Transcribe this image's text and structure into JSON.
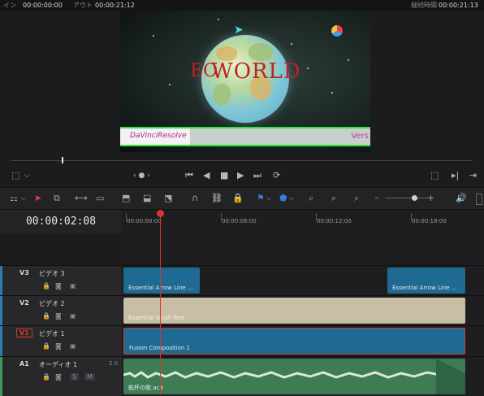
{
  "topbar": {
    "in_label": "イン",
    "in_time": "00:00:00:00",
    "out_label": "アウト",
    "out_time": "00:00:21:12",
    "duration_label": "継続時間",
    "duration_time": "00:00:21:13"
  },
  "viewer": {
    "overlay_text": "WORLD",
    "overlay_prefix": "EO",
    "scroll_left_text": "DaVinciResolve",
    "scroll_right_text": "Vers"
  },
  "timeline": {
    "current_timecode": "00:00:02:08",
    "ruler_labels": [
      "00:00:00:00",
      "00:00:06:00",
      "00:00:12:00",
      "00:00:18:00"
    ],
    "tracks": [
      {
        "id": "V3",
        "name": "ビデオ 3",
        "color": "#2a7bb0"
      },
      {
        "id": "V2",
        "name": "ビデオ 2",
        "color": "#2a7bb0"
      },
      {
        "id": "V1",
        "name": "ビデオ 1",
        "color": "#2a7bb0"
      },
      {
        "id": "A1",
        "name": "オーディオ 1",
        "level": "2.0",
        "color": "#3c9a5a"
      }
    ],
    "clips": {
      "v3_a": "Essential Arrow Line ...",
      "v3_b": "Essential Arrow Line ...",
      "v2": "Essential Scroll Text",
      "v1": "Fusion Composition 1",
      "a1": "乾杯の歌.ac3"
    },
    "audio_buttons": {
      "solo": "S",
      "mute": "M"
    }
  },
  "icons": [
    "crop-icon",
    "chevron-down-icon",
    "prev-edit-icon",
    "loop-icon",
    "skip-back-icon",
    "step-back-icon",
    "stop-icon",
    "play-icon",
    "skip-forward-icon",
    "repeat-icon",
    "pointer-icon",
    "razor-icon",
    "link-icon",
    "lock-icon",
    "flag-icon",
    "marker-icon",
    "zoom-icon",
    "volume-icon"
  ]
}
